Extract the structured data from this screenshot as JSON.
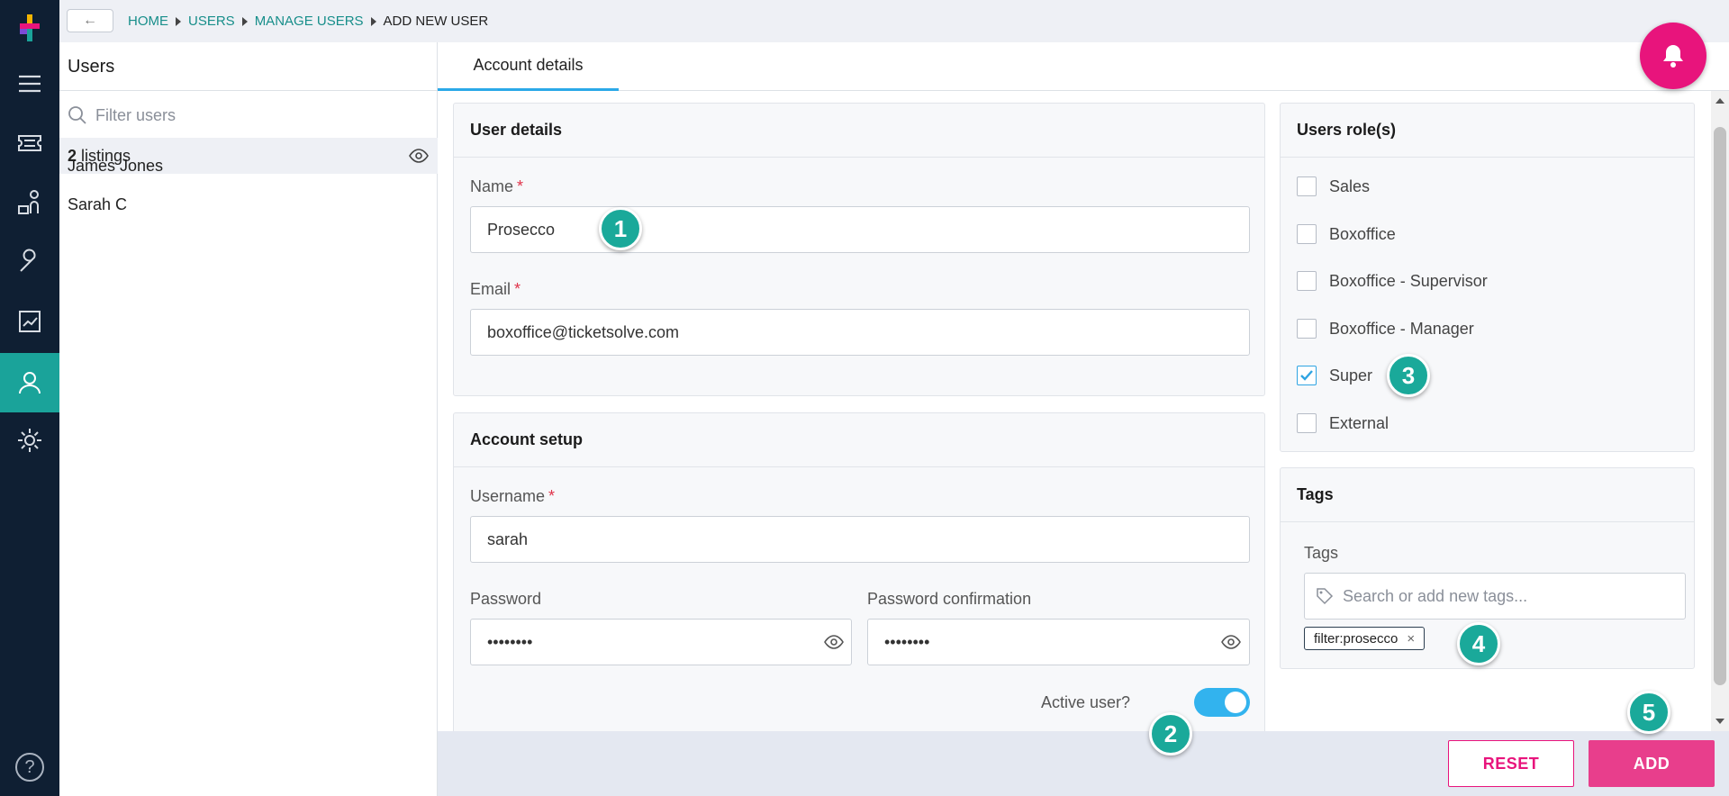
{
  "breadcrumb": [
    "HOME",
    "USERS",
    "MANAGE USERS",
    "ADD NEW USER"
  ],
  "sidebar": {
    "title": "Users",
    "filter_placeholder": "Filter users",
    "listing_count": "2",
    "listing_label": "listings",
    "users": [
      "James Jones",
      "Sarah C"
    ]
  },
  "tabs": [
    "Account details"
  ],
  "user_details": {
    "title": "User details",
    "name_label": "Name",
    "name_value": "Prosecco",
    "email_label": "Email",
    "email_value": "boxoffice@ticketsolve.com",
    "required_mark": "*"
  },
  "account_setup": {
    "title": "Account setup",
    "username_label": "Username",
    "username_value": "sarah",
    "password_label": "Password",
    "password_value": "••••••••",
    "password_confirm_label": "Password confirmation",
    "password_confirm_value": "••••••••",
    "active_label": "Active user?",
    "active": true
  },
  "roles": {
    "title": "Users role(s)",
    "items": [
      {
        "label": "Sales",
        "checked": false
      },
      {
        "label": "Boxoffice",
        "checked": false
      },
      {
        "label": "Boxoffice - Supervisor",
        "checked": false
      },
      {
        "label": "Boxoffice - Manager",
        "checked": false
      },
      {
        "label": "Super",
        "checked": true
      },
      {
        "label": "External",
        "checked": false
      }
    ]
  },
  "tags": {
    "title": "Tags",
    "label": "Tags",
    "placeholder": "Search or add new tags...",
    "chips": [
      {
        "label": "filter:prosecco",
        "remove": "×"
      }
    ]
  },
  "markers": [
    "1",
    "2",
    "3",
    "4",
    "5"
  ],
  "footer": {
    "reset_label": "RESET",
    "add_label": "ADD"
  },
  "help_glyph": "?",
  "back_glyph": "←",
  "colors": {
    "nav_bg": "#0f1f33",
    "nav_active": "#1aa39a",
    "accent_pink": "#e8147c",
    "add_button": "#e83e8c",
    "marker": "#1aa99a",
    "toggle": "#32b3ee",
    "link": "#178e8a"
  }
}
